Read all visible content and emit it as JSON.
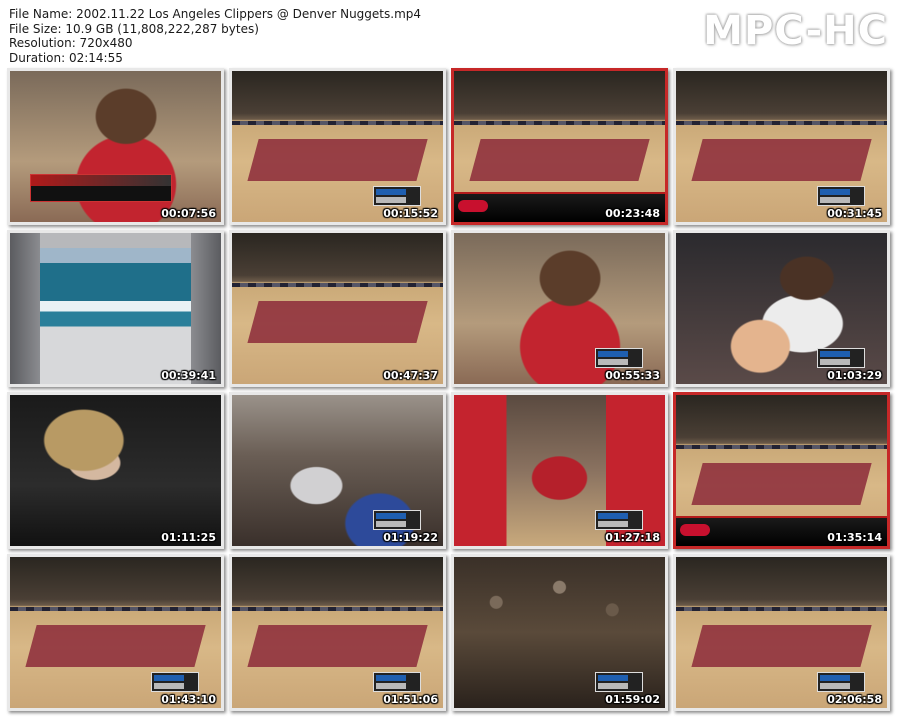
{
  "header": {
    "file_name_line": "File Name: 2002.11.22 Los Angeles Clippers @ Denver Nuggets.mp4",
    "file_size_line": "File Size: 10.9 GB (11,808,222,287 bytes)",
    "resolution_line": "Resolution: 720x480",
    "duration_line": "Duration: 02:14:55",
    "logo": "MPC-HC"
  },
  "thumbnails": [
    {
      "time": "00:07:56",
      "scene": "closeup-red"
    },
    {
      "time": "00:15:52",
      "scene": "court"
    },
    {
      "time": "00:23:48",
      "scene": "court",
      "frame": "red"
    },
    {
      "time": "00:31:45",
      "scene": "court"
    },
    {
      "time": "00:39:41",
      "scene": "wave"
    },
    {
      "time": "00:47:37",
      "scene": "court"
    },
    {
      "time": "00:55:33",
      "scene": "closeup-red"
    },
    {
      "time": "01:03:29",
      "scene": "closeup-white"
    },
    {
      "time": "01:11:25",
      "scene": "dark-person"
    },
    {
      "time": "01:19:22",
      "scene": "bench"
    },
    {
      "time": "01:27:18",
      "scene": "players-red"
    },
    {
      "time": "01:35:14",
      "scene": "court",
      "frame": "red"
    },
    {
      "time": "01:43:10",
      "scene": "court"
    },
    {
      "time": "01:51:06",
      "scene": "court"
    },
    {
      "time": "01:59:02",
      "scene": "crowd"
    },
    {
      "time": "02:06:58",
      "scene": "court"
    }
  ]
}
